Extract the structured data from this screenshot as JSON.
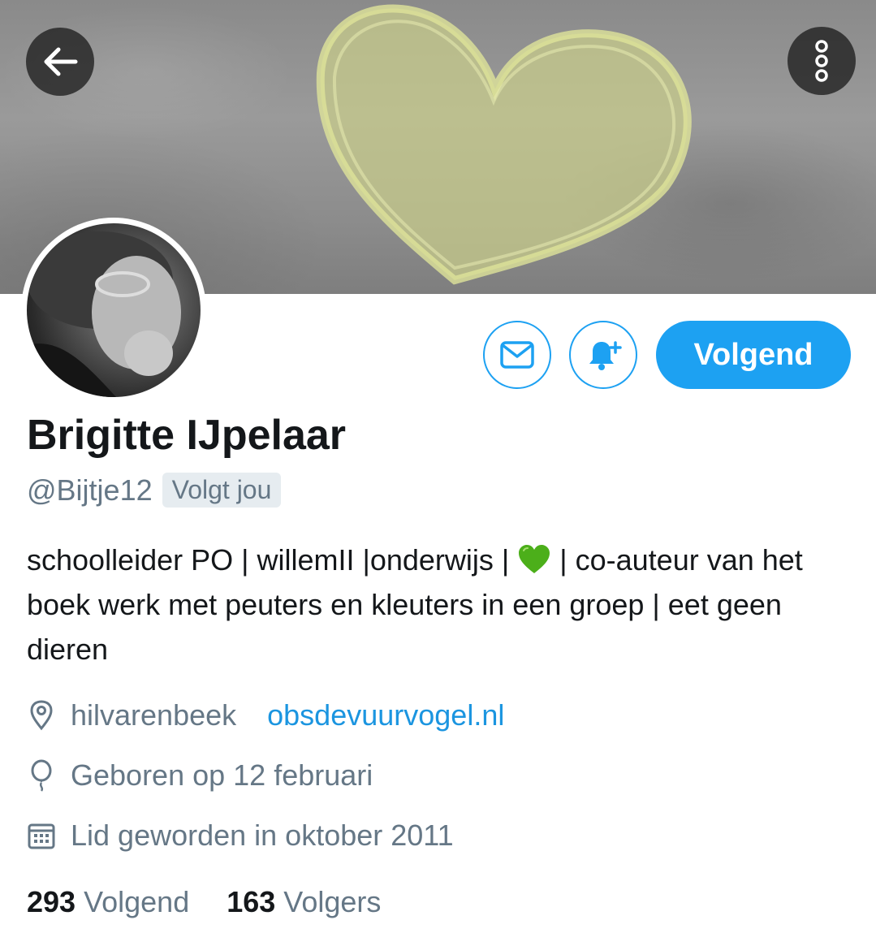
{
  "profile": {
    "name": "Brigitte IJpelaar",
    "handle": "@Bijtje12",
    "follows_you": "Volgt jou",
    "bio_part1": "schoolleider PO | willemII |onderwijs | ",
    "bio_part2": " | co-auteur van het boek werk met peuters en kleuters in een groep | eet geen dieren",
    "location": "hilvarenbeek",
    "website": "obsdevuurvogel.nl",
    "birthday": "Geboren op 12 februari",
    "joined": "Lid geworden in oktober 2011"
  },
  "actions": {
    "follow_label": "Volgend"
  },
  "stats": {
    "following_count": "293",
    "following_label": "Volgend",
    "followers_count": "163",
    "followers_label": "Volgers"
  },
  "icons": {
    "back": "arrow-left-icon",
    "more": "more-vertical-icon",
    "dm": "envelope-icon",
    "notify": "bell-plus-icon",
    "location": "location-pin-icon",
    "birthday": "balloon-icon",
    "joined": "calendar-icon"
  },
  "colors": {
    "accent": "#1da1f2",
    "link": "#1b95e0",
    "secondary_text": "#657786",
    "emoji_heart": "#4caf1a"
  }
}
